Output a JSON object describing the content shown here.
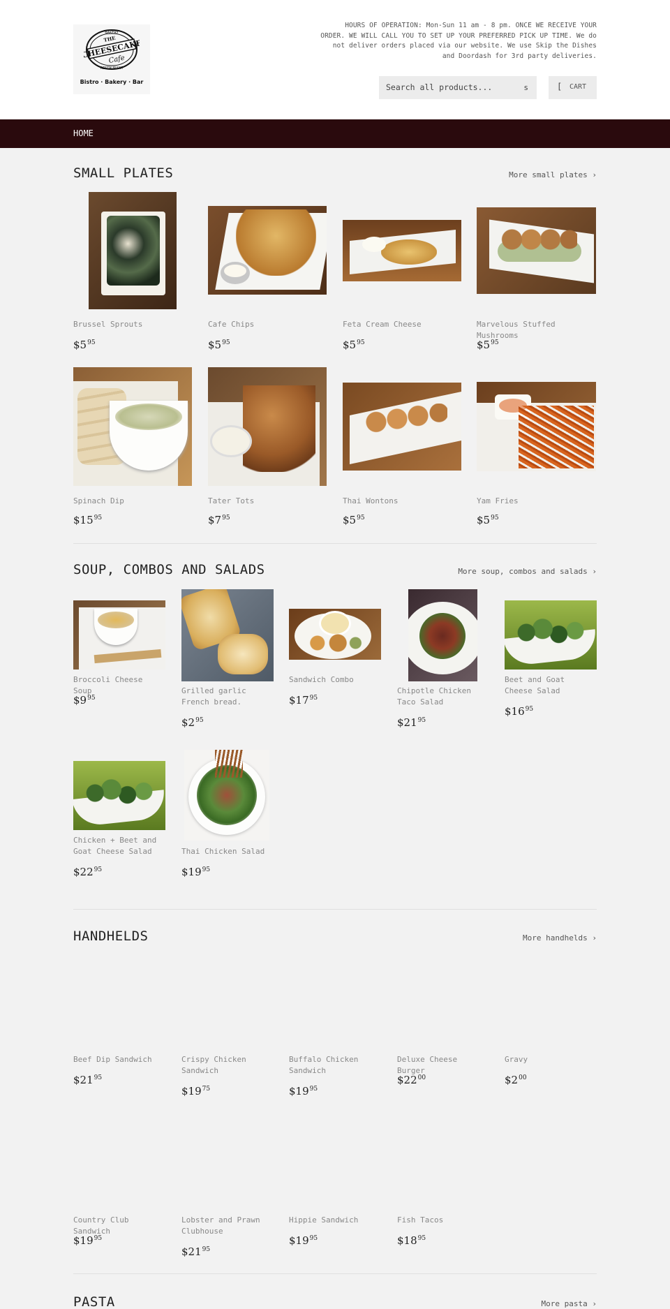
{
  "header": {
    "logo_text": "THE CHEESECAKE CAFE BAKERY RESTAURANT",
    "logo_sub": "Bistro · Bakery · Bar",
    "hours": "HOURS OF OPERATION: Mon-Sun 11 am - 8 pm. ONCE WE RECEIVE YOUR ORDER. WE WILL CALL YOU TO SET UP YOUR PREFERRED PICK UP TIME. We do not deliver orders placed via our website. We use Skip the Dishes and Doordash for 3rd party deliveries.",
    "search_placeholder": "Search all products...",
    "search_icon": "s",
    "cart_icon": "[",
    "cart_label": "CART"
  },
  "nav": {
    "home": "HOME"
  },
  "sections": {
    "small_plates": {
      "title": "SMALL PLATES",
      "more": "More small plates ›",
      "products": [
        {
          "name": "Brussel Sprouts",
          "dollars": "$5",
          "cents": "95"
        },
        {
          "name": "Cafe Chips",
          "dollars": "$5",
          "cents": "95"
        },
        {
          "name": "Feta Cream Cheese",
          "dollars": "$5",
          "cents": "95"
        },
        {
          "name": "Marvelous Stuffed Mushrooms",
          "dollars": "$5",
          "cents": "95"
        },
        {
          "name": "Spinach Dip",
          "dollars": "$15",
          "cents": "95"
        },
        {
          "name": "Tater Tots",
          "dollars": "$7",
          "cents": "95"
        },
        {
          "name": "Thai Wontons",
          "dollars": "$5",
          "cents": "95"
        },
        {
          "name": "Yam Fries",
          "dollars": "$5",
          "cents": "95"
        }
      ]
    },
    "soup": {
      "title": "SOUP, COMBOS AND SALADS",
      "more": "More soup, combos and salads ›",
      "products": [
        {
          "name": "Broccoli Cheese Soup",
          "dollars": "$9",
          "cents": "95"
        },
        {
          "name": "Grilled garlic French bread.",
          "dollars": "$2",
          "cents": "95"
        },
        {
          "name": "Sandwich Combo",
          "dollars": "$17",
          "cents": "95"
        },
        {
          "name": "Chipotle Chicken Taco Salad",
          "dollars": "$21",
          "cents": "95"
        },
        {
          "name": "Beet and Goat Cheese Salad",
          "dollars": "$16",
          "cents": "95"
        },
        {
          "name": "Chicken + Beet and Goat Cheese Salad",
          "dollars": "$22",
          "cents": "95"
        },
        {
          "name": "Thai Chicken Salad",
          "dollars": "$19",
          "cents": "95"
        }
      ]
    },
    "handhelds": {
      "title": "HANDHELDS",
      "more": "More handhelds ›",
      "products": [
        {
          "name": "Beef Dip Sandwich",
          "dollars": "$21",
          "cents": "95"
        },
        {
          "name": "Crispy Chicken Sandwich",
          "dollars": "$19",
          "cents": "75"
        },
        {
          "name": "Buffalo Chicken Sandwich",
          "dollars": "$19",
          "cents": "95"
        },
        {
          "name": "Deluxe Cheese Burger",
          "dollars": "$22",
          "cents": "00"
        },
        {
          "name": "Gravy",
          "dollars": "$2",
          "cents": "00"
        },
        {
          "name": "Country Club Sandwich",
          "dollars": "$19",
          "cents": "95"
        },
        {
          "name": "Lobster and Prawn Clubhouse",
          "dollars": "$21",
          "cents": "95"
        },
        {
          "name": "Hippie Sandwich",
          "dollars": "$19",
          "cents": "95"
        },
        {
          "name": "Fish Tacos",
          "dollars": "$18",
          "cents": "95"
        }
      ]
    },
    "pasta": {
      "title": "PASTA",
      "more": "More pasta ›"
    }
  }
}
